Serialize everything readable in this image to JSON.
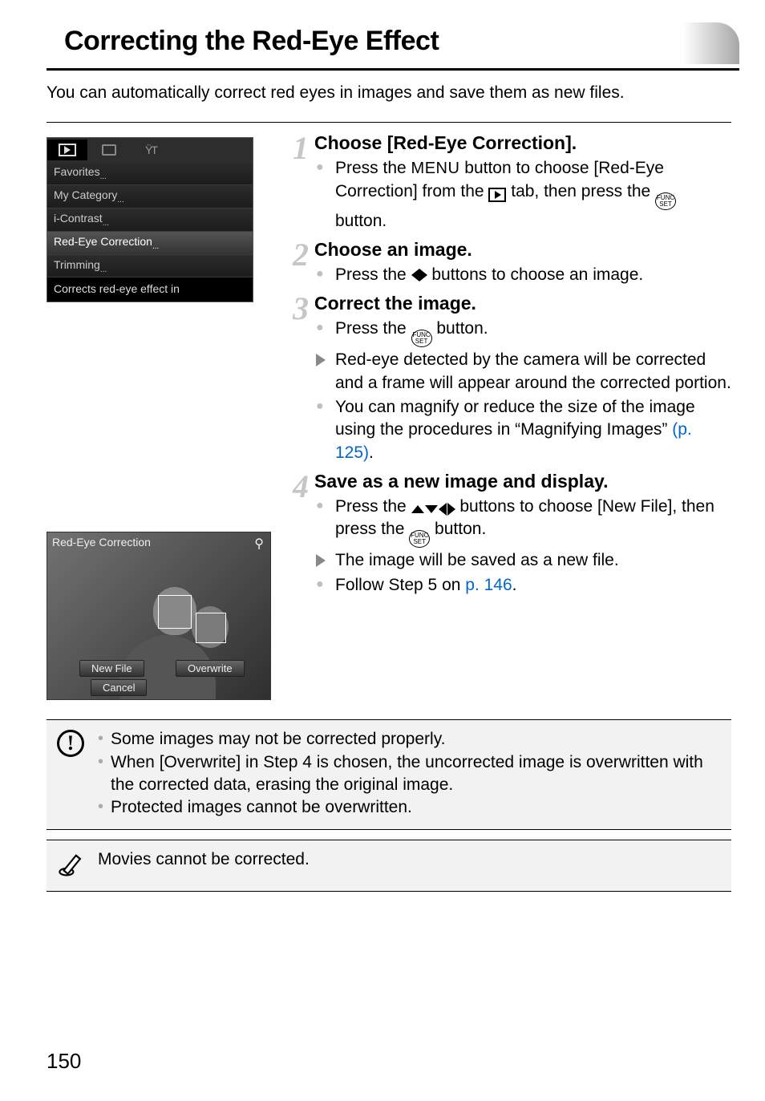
{
  "page": {
    "title": "Correcting the Red-Eye Effect",
    "intro": "You can automatically correct red eyes in images and save them as new files.",
    "page_number": "150"
  },
  "menu": {
    "items": [
      "Favorites",
      "My Category",
      "i-Contrast",
      "Red-Eye Correction",
      "Trimming"
    ],
    "help": "Corrects red-eye effect in"
  },
  "redeye_screen": {
    "title": "Red-Eye Correction",
    "new_file": "New File",
    "overwrite": "Overwrite",
    "cancel": "Cancel"
  },
  "steps": {
    "s1": {
      "title": "Choose [Red-Eye Correction].",
      "b1a": "Press the ",
      "b1b": " button to choose [Red-Eye Correction] from the ",
      "b1c": " tab, then press the ",
      "b1d": " button.",
      "menu_word": "MENU"
    },
    "s2": {
      "title": "Choose an image.",
      "b1a": "Press the ",
      "b1b": " buttons to choose an image."
    },
    "s3": {
      "title": "Correct the image.",
      "b1a": "Press the ",
      "b1b": " button.",
      "b2": "Red-eye detected by the camera will be corrected and a frame will appear around the corrected portion.",
      "b3a": "You can magnify or reduce the size of the image using the procedures in “Magnifying Images” ",
      "b3_link": "(p. 125)",
      "b3b": "."
    },
    "s4": {
      "title": "Save as a new image and display.",
      "b1a": "Press the ",
      "b1b": " buttons to choose [New File], then press the ",
      "b1c": " button.",
      "b2": "The image will be saved as a new file.",
      "b3a": "Follow Step 5 on ",
      "b3_link": "p. 146",
      "b3b": "."
    }
  },
  "notes": {
    "warn1": "Some images may not be corrected properly.",
    "warn2": "When [Overwrite] in Step 4 is chosen, the uncorrected image is overwritten with the corrected data, erasing the original image.",
    "warn3": "Protected images cannot be overwritten.",
    "info": "Movies cannot be corrected."
  }
}
